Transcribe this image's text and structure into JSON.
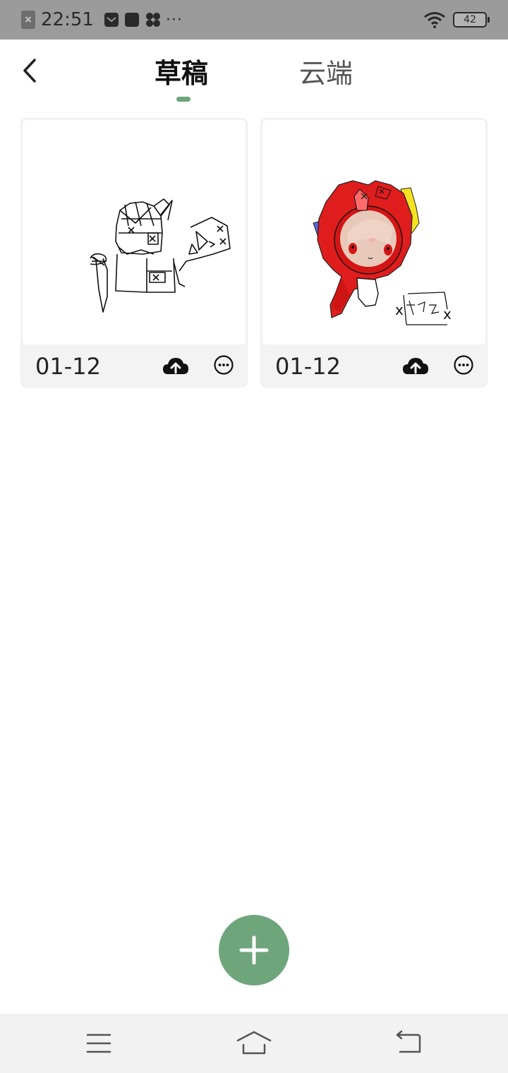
{
  "status_bar": {
    "time": "22:51",
    "more": "···",
    "battery": "42"
  },
  "header": {
    "tabs": [
      {
        "label": "草稿",
        "active": true
      },
      {
        "label": "云端",
        "active": false
      }
    ]
  },
  "drafts": [
    {
      "date": "01-12",
      "thumbnail": "black-sketch-drawing"
    },
    {
      "date": "01-12",
      "thumbnail": "red-character-drawing"
    }
  ],
  "colors": {
    "accent": "#6fa57b",
    "status_bar": "#9b9b9b",
    "nav_bar": "#f2f2f2"
  },
  "icons": {
    "back": "chevron-left-icon",
    "upload": "cloud-upload-icon",
    "more": "more-horizontal-circle-icon",
    "add": "plus-icon",
    "nav_menu": "menu-icon",
    "nav_home": "home-icon",
    "nav_back": "return-icon"
  }
}
